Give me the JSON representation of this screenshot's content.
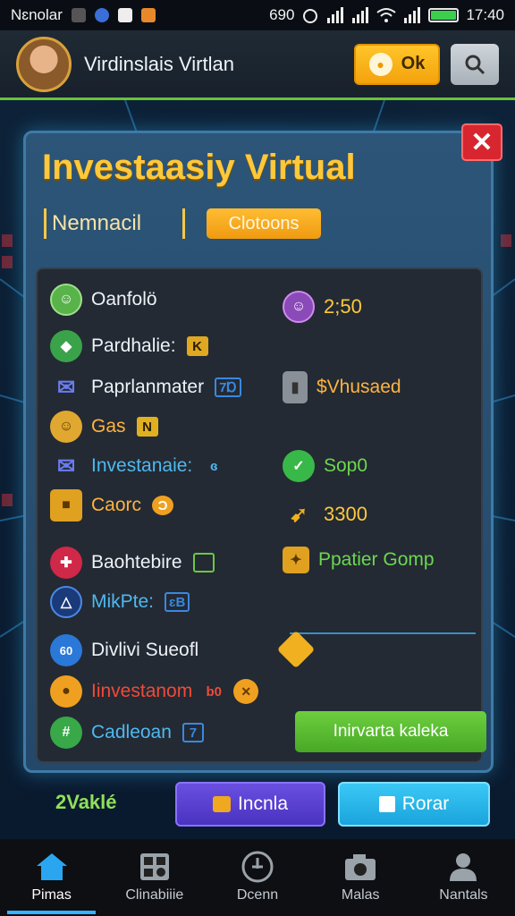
{
  "status_bar": {
    "carrier": "Nɛnolar",
    "left_icons": [
      "sim-icon",
      "browser-icon",
      "media-icon",
      "app-icon"
    ],
    "signal_text": "690",
    "time": "17:40"
  },
  "header": {
    "username": "Virdinslais Virtlan",
    "primary_button_label": "Ok",
    "accent_color": "#67c23a"
  },
  "modal": {
    "title": "Investaasiy Virtual",
    "tab_active": "Nemnacil",
    "tab_button": "Clotoons",
    "close_symbol": "✕",
    "left_rows": [
      {
        "label": "Oanfolö",
        "badge": "",
        "icon": "face-icon"
      },
      {
        "label": "Pardhalie:",
        "badge": "K",
        "icon": "diamond-icon"
      },
      {
        "label": "Paprlanmater",
        "badge": "7Ɒ",
        "icon": "mail-icon"
      },
      {
        "label": "Gas",
        "badge": "N",
        "icon": "coin-icon"
      },
      {
        "label": "Investanaie:",
        "badge": "ɞ",
        "icon": "mail-icon"
      },
      {
        "label": "Caorc",
        "badge": "Ɔ",
        "icon": "box-icon"
      },
      {
        "label": "Baohtebire",
        "badge": "",
        "icon": "puzzle-icon"
      },
      {
        "label": "MikPte:",
        "badge": "ɛB",
        "icon": "triangle-icon"
      },
      {
        "label": "Divlivi Sueofl",
        "badge": "",
        "icon": "coin-icon"
      },
      {
        "label": "Iinvestanom",
        "badge": "b0",
        "icon": "coin-icon"
      },
      {
        "label": "Cadleoan",
        "badge": "7",
        "icon": "hash-icon"
      }
    ],
    "right_rows": [
      {
        "label": "2;50",
        "icon": "avatar-icon"
      },
      {
        "label": "$Vhusaed",
        "icon": "shield-icon"
      },
      {
        "label": "Sop0",
        "icon": "check-icon"
      },
      {
        "label": "3300",
        "icon": "arrow-icon"
      },
      {
        "label": "Ppatier Gomp",
        "icon": "box-icon"
      },
      {
        "label": "",
        "icon": "diamond-icon"
      }
    ],
    "green_button_label": "Inirvarta kaleka"
  },
  "footer": {
    "balance": "2Vaklé",
    "purple_button_label": "Incnla",
    "blue_button_label": "Rorar"
  },
  "nav": {
    "items": [
      {
        "label": "Pimas",
        "icon": "home-icon",
        "active": true
      },
      {
        "label": "Clinabiiie",
        "icon": "grid-icon",
        "active": false
      },
      {
        "label": "Dcenn",
        "icon": "compass-icon",
        "active": false
      },
      {
        "label": "Malas",
        "icon": "camera-icon",
        "active": false
      },
      {
        "label": "Nantals",
        "icon": "user-icon",
        "active": false
      }
    ]
  }
}
